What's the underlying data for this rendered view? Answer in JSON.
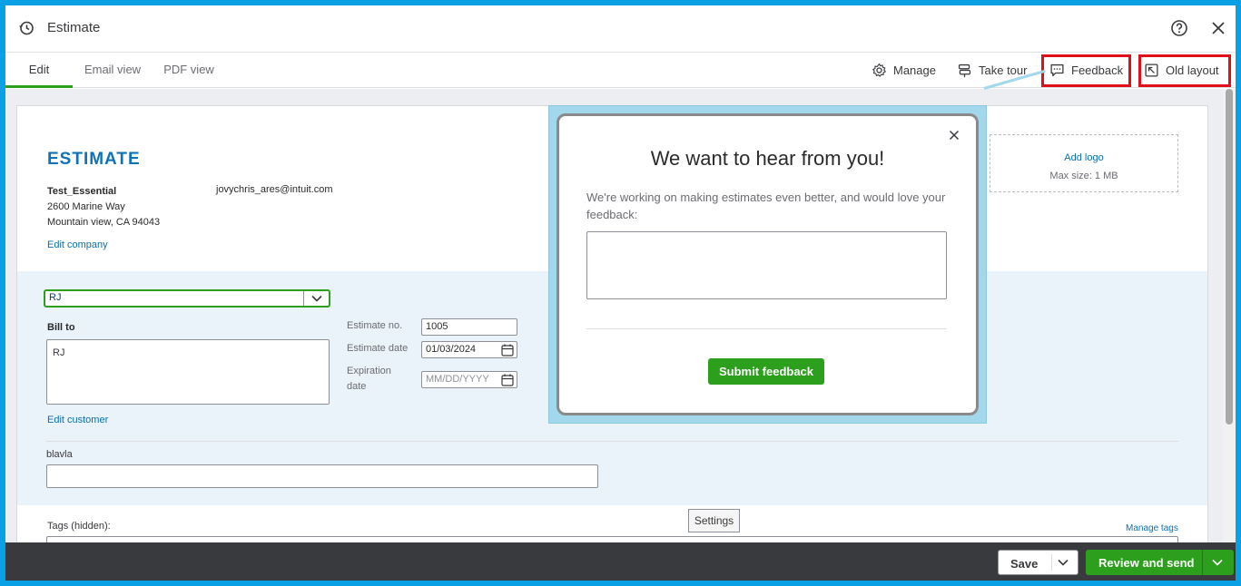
{
  "header": {
    "title": "Estimate"
  },
  "tabs": [
    {
      "label": "Edit"
    },
    {
      "label": "Email view"
    },
    {
      "label": "PDF view"
    }
  ],
  "toolbar": {
    "manage": "Manage",
    "take_tour": "Take tour",
    "feedback": "Feedback",
    "old_layout": "Old layout"
  },
  "form": {
    "heading": "ESTIMATE",
    "company": {
      "name": "Test_Essential",
      "address1": "2600 Marine Way",
      "address2": "Mountain view, CA 94043",
      "email": "jovychris_ares@intuit.com",
      "edit_link": "Edit company"
    },
    "logo": {
      "add": "Add logo",
      "max_size": "Max size: 1 MB"
    },
    "customer": {
      "selected": "RJ",
      "bill_to_label": "Bill to",
      "bill_to_value": "RJ",
      "edit_link": "Edit customer"
    },
    "estimate_no": {
      "label": "Estimate no.",
      "value": "1005"
    },
    "estimate_date": {
      "label": "Estimate date",
      "value": "01/03/2024"
    },
    "expiration_date": {
      "label_line1": "Expiration",
      "label_line2": "date",
      "placeholder": "MM/DD/YYYY"
    },
    "custom_field_label": "blavla",
    "tags_label": "Tags (hidden):",
    "manage_tags": "Manage tags"
  },
  "tooltip": "Settings",
  "feedback_popover": {
    "title": "We want to hear from you!",
    "description": "We're working on making estimates even better, and would love your feedback:",
    "submit": "Submit feedback"
  },
  "footer": {
    "save": "Save",
    "review_send": "Review and send"
  },
  "colors": {
    "accent_green": "#2ca01c",
    "link_blue": "#0d6fae",
    "highlight_red": "#e0101a",
    "frame_blue": "#0aa0e6"
  }
}
